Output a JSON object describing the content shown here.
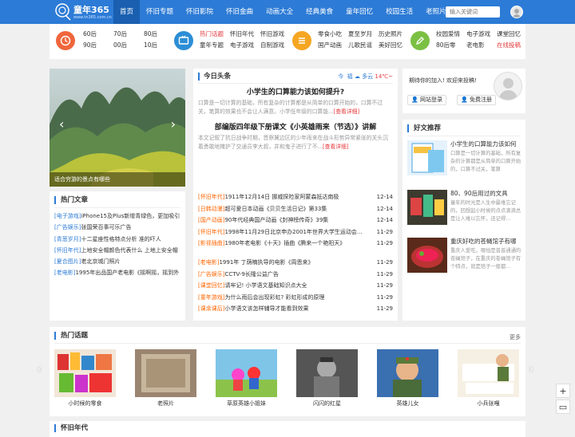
{
  "brand": {
    "name": "童年365",
    "url": "www.tn365.com.cn"
  },
  "nav": [
    "首页",
    "怀旧专题",
    "怀旧影院",
    "怀旧金曲",
    "动画大全",
    "经典美食",
    "童年回忆",
    "校园生活",
    "老照片"
  ],
  "search": {
    "placeholder": "输入关键词"
  },
  "categories": [
    {
      "icon": "clock-icon",
      "color": "#f0663c",
      "links": [
        "60后",
        "70后",
        "80后",
        "90后",
        "00后",
        "10后"
      ]
    },
    {
      "icon": "tv-icon",
      "color": "#2c8ed6",
      "links": [
        "热门话题",
        "怀旧年代",
        "怀旧游戏",
        "童年专题",
        "电子游戏",
        "自制游戏"
      ]
    },
    {
      "icon": "list-icon",
      "color": "#f5a623",
      "links": [
        "零食小吃",
        "夏至岁月",
        "历史照片",
        "国产动画",
        "儿歌民谣",
        "美好回忆"
      ]
    },
    {
      "icon": "pencil-icon",
      "color": "#7bc043",
      "links": [
        "校园爱情",
        "电子游戏",
        "课堂回忆",
        "80后零",
        "老电影",
        "在线投稿"
      ]
    }
  ],
  "slider": {
    "caption": "适合穷游的景点有哪些"
  },
  "hot_articles": {
    "title": "热门文章",
    "items": [
      {
        "tag": "[电子游戏]",
        "text": "iPhone15及Plus新增青绿色，更加吸引"
      },
      {
        "tag": "[广告娱乐]",
        "text": "张国荣百事可乐广告"
      },
      {
        "tag": "[青葱岁月]",
        "text": "十二星座性格特点分析 准的吓人"
      },
      {
        "tag": "[怀旧年代]",
        "text": "上地安全帽颜色代表什么 上地上安全帽"
      },
      {
        "tag": "[夏合图片]",
        "text": "老北京城门照片"
      },
      {
        "tag": "[老电影]",
        "text": "1995年出品国产老电影《摇啊摇，摇到外"
      }
    ]
  },
  "headlines": {
    "title": "今日头条",
    "weather": {
      "day": "今",
      "loc": "福",
      "cond": "多云",
      "temp": "14℃~"
    },
    "lead1": {
      "title": "小学生的口算能力该如何提升?",
      "desc": "口算是一切计算的基础，所有复杂的计算都是从简单的口算开始的，口算不过关，笔算的效果也不会让人满意。小学低年级的口算能...",
      "more": "[查看详细]"
    },
    "lead2": {
      "title": "部编版四年级下册课文《小英雄雨来（节选）》讲解",
      "desc": "本文记叙了抗日战争时期，晋察冀边区的少年雨来在战斗形势异常紧张的关头沉着勇敢地掩护了交通员李大叔，并和鬼子进行了不...",
      "more": "[查看详细]"
    },
    "news": [
      {
        "tag": "[怀旧年代]",
        "text": "1911年12月14日 挪威探险家阿蒙森抵达南极",
        "date": "12-14"
      },
      {
        "tag": "[日韩动漫]",
        "text": "超可爱日本动画《贝贝生活日记》第33集",
        "date": "12-14"
      },
      {
        "tag": "[国产动画]",
        "text": "90年代经典国产动画《封神榜传奇》39集",
        "date": "12-14"
      },
      {
        "tag": "[怀旧年代]",
        "text": "1998年11月29日北京申办2001年世界大学生运动会...",
        "date": "11-29"
      },
      {
        "tag": "[影视插曲]",
        "text": "1980年老电影《十天》插曲《腾来一个艳阳天》",
        "date": "11-29"
      }
    ],
    "news2": [
      {
        "tag": "[老电影]",
        "text": "1991年 丁荫楠执导的电影《周恩来》",
        "date": "11-29"
      },
      {
        "tag": "[广告娱乐]",
        "text": "CCTV-9长隆公益广告",
        "date": "11-29"
      },
      {
        "tag": "[课堂回忆]",
        "text": "请牢记! 小学语文基础知识点大全",
        "date": "11-29"
      },
      {
        "tag": "[童年游戏]",
        "text": "为什么雨后会出现彩虹? 彩虹形成的原理",
        "date": "11-29"
      },
      {
        "tag": "[课余课后]",
        "text": "小学语文该怎样辅导才能看到效果",
        "date": "11-29"
      }
    ]
  },
  "login": {
    "msg": "期待你的加入! 欢迎来投稿!",
    "btn1": "网站登录",
    "btn2": "免费注册"
  },
  "recommend": {
    "title": "好文推荐",
    "items": [
      {
        "title": "小学生的口算能力该如何",
        "desc": "口算是一切计算的基础，所有复杂的计算都是从简单的口算开始的，口算不过关，笔算"
      },
      {
        "title": "80、90后用过的文具",
        "desc": "童年的时光是人生中最难忘记的，回想起小时候的点点滴滴总是让人难以忘怀，还记得..."
      },
      {
        "title": "重庆好吃的苍蝇馆子有哪",
        "desc": "重庆人爱吃，哪怕是普普通通的苍蝇馆子，在重庆的苍蝇馆子有个特点，就是馆子一般都..."
      }
    ]
  },
  "topics": {
    "title": "热门话题",
    "more": "更多",
    "items": [
      "小时候的零食",
      "老照片",
      "草原英雄小姐妹",
      "闪闪的红星",
      "英雄儿女",
      "小兵张嘎"
    ]
  },
  "years": {
    "title": "怀旧年代"
  },
  "fabs": [
    "+",
    "▭"
  ]
}
